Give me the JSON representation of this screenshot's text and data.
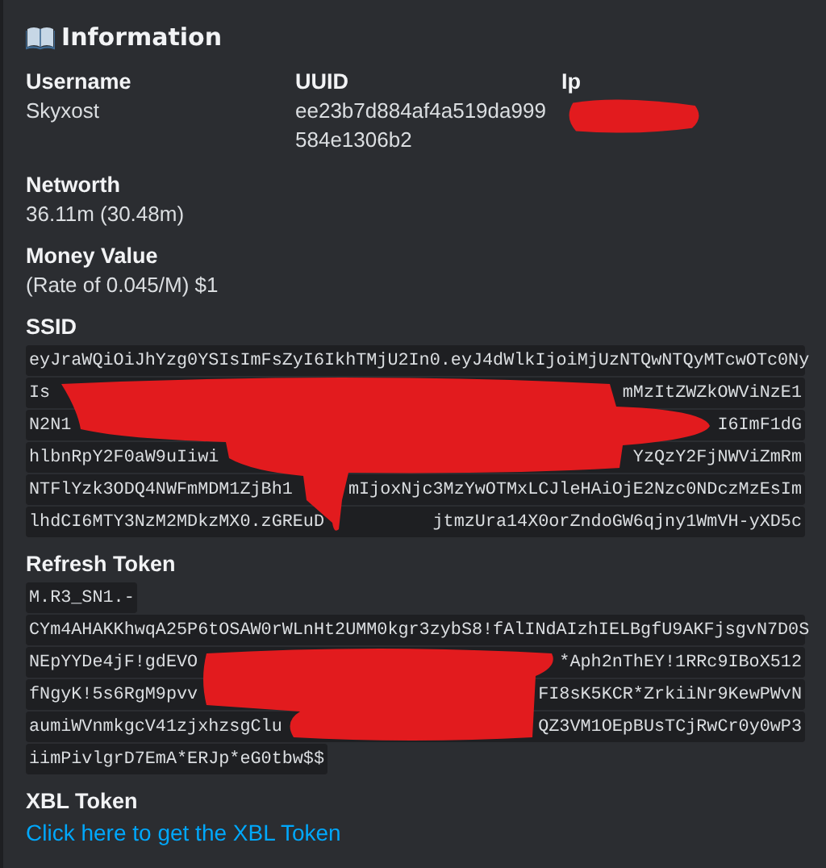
{
  "embed": {
    "title": "Information",
    "fields": [
      {
        "name": "Username",
        "value": [
          "Skyxost"
        ]
      },
      {
        "name": "UUID",
        "value": [
          "ee23b7d884af4a519da999",
          "584e1306b2"
        ]
      },
      {
        "name": "Ip"
      }
    ],
    "networth": {
      "name": "Networth",
      "value": "36.11m (30.48m)"
    },
    "money": {
      "name": "Money Value",
      "value": "(Rate of 0.045/M) $1"
    },
    "ssid": {
      "name": "SSID",
      "lines": [
        {
          "left": "eyJraWQiOiJhYzg0YSIsImFsZyI6IkhTMjU2In0.eyJ4dWlkIjoiMjUzNTQwNTQyMTcwOTc0Ny"
        },
        {
          "left": "Is",
          "right": "mMzItZWZkOWViNzE1"
        },
        {
          "left": "N2N1",
          "right": "I6ImF1dG"
        },
        {
          "left": "hlbnRpY2F0aW9uIiwi",
          "right": "YzQzY2FjNWViZmRm"
        },
        {
          "left": "NTFlYzk3ODQ4NWFmMDM1ZjBh1",
          "right": "mIjoxNjc3MzYwOTMxLCJleHAiOjE2Nzc0NDczMzEsIm"
        },
        {
          "left": "lhdCI6MTY3NzM2MDkzMX0.zGREuD",
          "right": "jtmzUra14X0orZndoGW6qjny1WmVH-yXD5c"
        }
      ]
    },
    "refresh": {
      "name": "Refresh Token",
      "lines": [
        {
          "left": "M.R3_SN1.-"
        },
        {
          "left": "CYm4AHAKKhwqA25P6tOSAW0rWLnHt2UMM0kgr3zybS8!fAlINdAIzhIELBgfU9AKFjsgvN7D0S"
        },
        {
          "left": "NEpYYDe4jF!gdEVO",
          "right": "*Aph2nThEY!1RRc9IBoX512"
        },
        {
          "left": "fNgyK!5s6RgM9pvv",
          "right": "FI8sK5KCR*ZrkiiNr9KewPWvN"
        },
        {
          "left": "aumiWVnmkgcV41zjxhzsgClu",
          "right": "QZ3VM1OEpBUsTCjRwCr0y0wP3"
        },
        {
          "left": "iimPivlgrD7EmA*ERJp*eG0tbw$$"
        }
      ]
    },
    "xbl": {
      "name": "XBL Token",
      "link": "Click here to get the XBL Token"
    }
  }
}
